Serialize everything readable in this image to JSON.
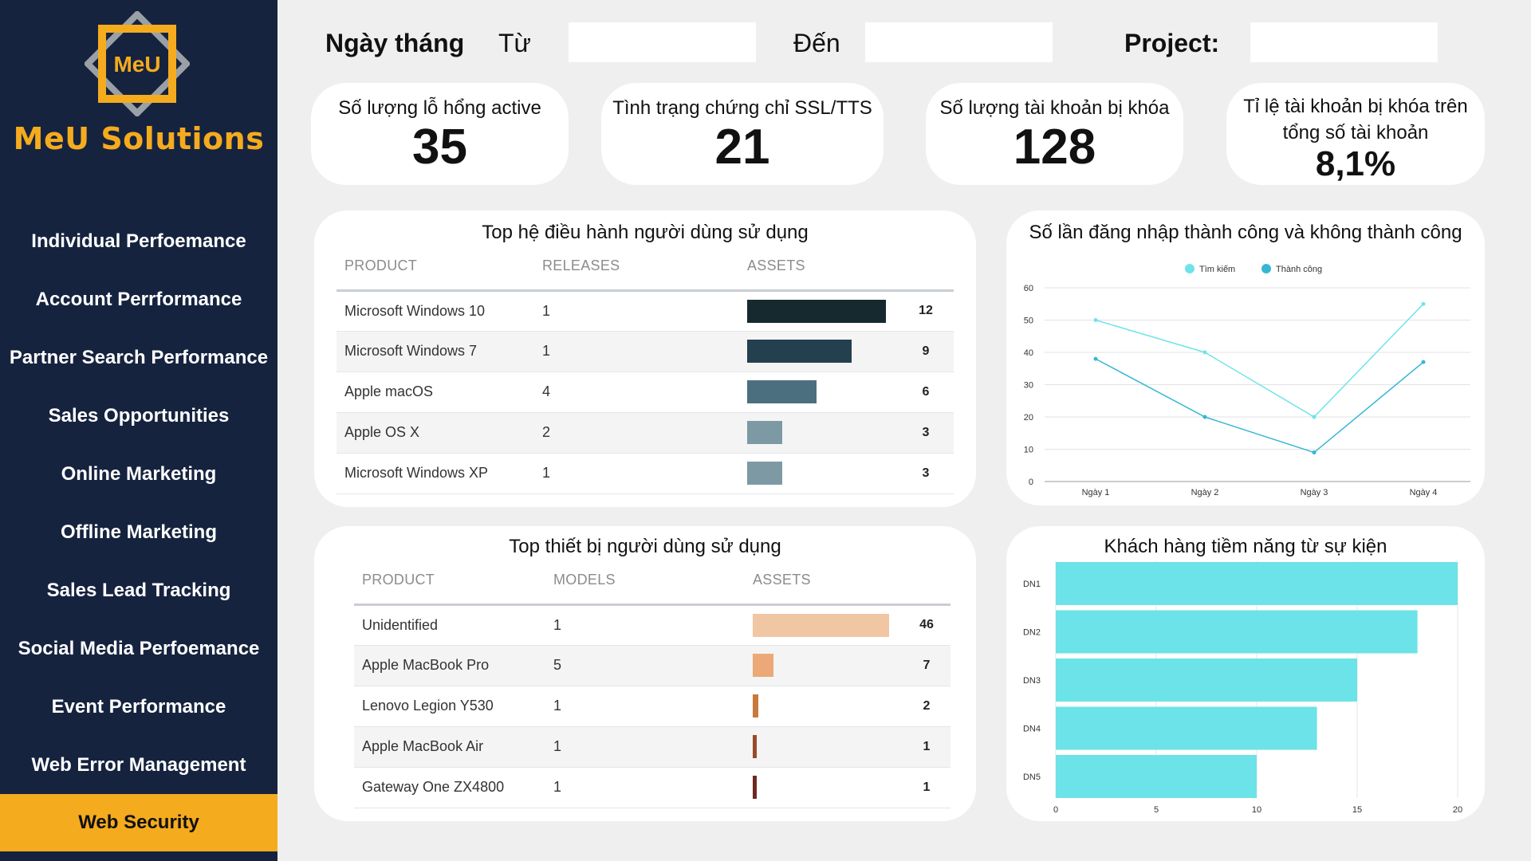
{
  "brand": {
    "name": "MeU Solutions",
    "logo_text": "MeU"
  },
  "nav": [
    {
      "label": "Individual Perfoemance"
    },
    {
      "label": "Account Perrformance"
    },
    {
      "label": "Partner Search Performance"
    },
    {
      "label": "Sales Opportunities"
    },
    {
      "label": "Online Marketing"
    },
    {
      "label": "Offline Marketing"
    },
    {
      "label": "Sales Lead Tracking"
    },
    {
      "label": "Social Media Perfoemance"
    },
    {
      "label": "Event Performance"
    },
    {
      "label": "Web Error Management"
    },
    {
      "label": "Web Security",
      "active": true
    }
  ],
  "filters": {
    "date_label": "Ngày tháng",
    "from_label": "Từ",
    "to_label": "Đến",
    "project_label": "Project:",
    "from_value": "",
    "to_value": "",
    "project_value": ""
  },
  "kpis": [
    {
      "label": "Số lượng lỗ hổng active",
      "value": "35"
    },
    {
      "label": "Tình trạng chứng chỉ SSL/TTS",
      "value": "21"
    },
    {
      "label": "Số lượng tài khoản bị khóa",
      "value": "128"
    },
    {
      "label": "Tỉ lệ tài khoản bị khóa trên tổng số tài khoản",
      "value": "8,1%"
    }
  ],
  "os_table": {
    "title": "Top hệ điều hành người dùng sử dụng",
    "headers": [
      "PRODUCT",
      "RELEASES",
      "ASSETS"
    ],
    "rows": [
      {
        "product": "Microsoft Windows 10",
        "releases": "1",
        "assets": 12,
        "color": "#16292f"
      },
      {
        "product": "Microsoft Windows 7",
        "releases": "1",
        "assets": 9,
        "color": "#243f4d"
      },
      {
        "product": "Apple macOS",
        "releases": "4",
        "assets": 6,
        "color": "#4c6f7f"
      },
      {
        "product": "Apple OS X",
        "releases": "2",
        "assets": 3,
        "color": "#7d9aa4"
      },
      {
        "product": "Microsoft Windows XP",
        "releases": "1",
        "assets": 3,
        "color": "#7d9aa4"
      }
    ]
  },
  "device_table": {
    "title": "Top thiết bị người dùng sử dụng",
    "headers": [
      "PRODUCT",
      "MODELS",
      "ASSETS"
    ],
    "rows": [
      {
        "product": "Unidentified",
        "models": "1",
        "assets": 46,
        "color": "#f1c6a2"
      },
      {
        "product": "Apple MacBook Pro",
        "models": "5",
        "assets": 7,
        "color": "#eca876"
      },
      {
        "product": "Lenovo Legion Y530",
        "models": "1",
        "assets": 2,
        "color": "#c8793d"
      },
      {
        "product": "Apple MacBook Air",
        "models": "1",
        "assets": 1,
        "color": "#9a4a2c"
      },
      {
        "product": "Gateway One ZX4800",
        "models": "1",
        "assets": 1,
        "color": "#6e2a1f"
      }
    ]
  },
  "chart_data": [
    {
      "type": "line",
      "title": "Số lần đăng nhập thành công và không thành công",
      "categories": [
        "Ngày 1",
        "Ngày 2",
        "Ngày 3",
        "Ngày 4"
      ],
      "series": [
        {
          "name": "Tìm kiếm",
          "values": [
            50,
            40,
            20,
            55
          ],
          "color": "#6fe3ea"
        },
        {
          "name": "Thành công",
          "values": [
            38,
            20,
            9,
            37
          ],
          "color": "#37b6d3"
        }
      ],
      "yticks": [
        0,
        10,
        20,
        30,
        40,
        50,
        60
      ],
      "ylim": [
        0,
        60
      ],
      "grid": true,
      "legend": "top"
    },
    {
      "type": "bar",
      "orientation": "horizontal",
      "title": "Khách hàng tiềm năng từ sự kiện",
      "categories": [
        "DN1",
        "DN2",
        "DN3",
        "DN4",
        "DN5"
      ],
      "values": [
        20,
        18,
        15,
        13,
        10
      ],
      "xticks": [
        0,
        5,
        10,
        15,
        20
      ],
      "xlim": [
        0,
        20
      ],
      "color": "#6be3e8",
      "grid": true
    }
  ]
}
